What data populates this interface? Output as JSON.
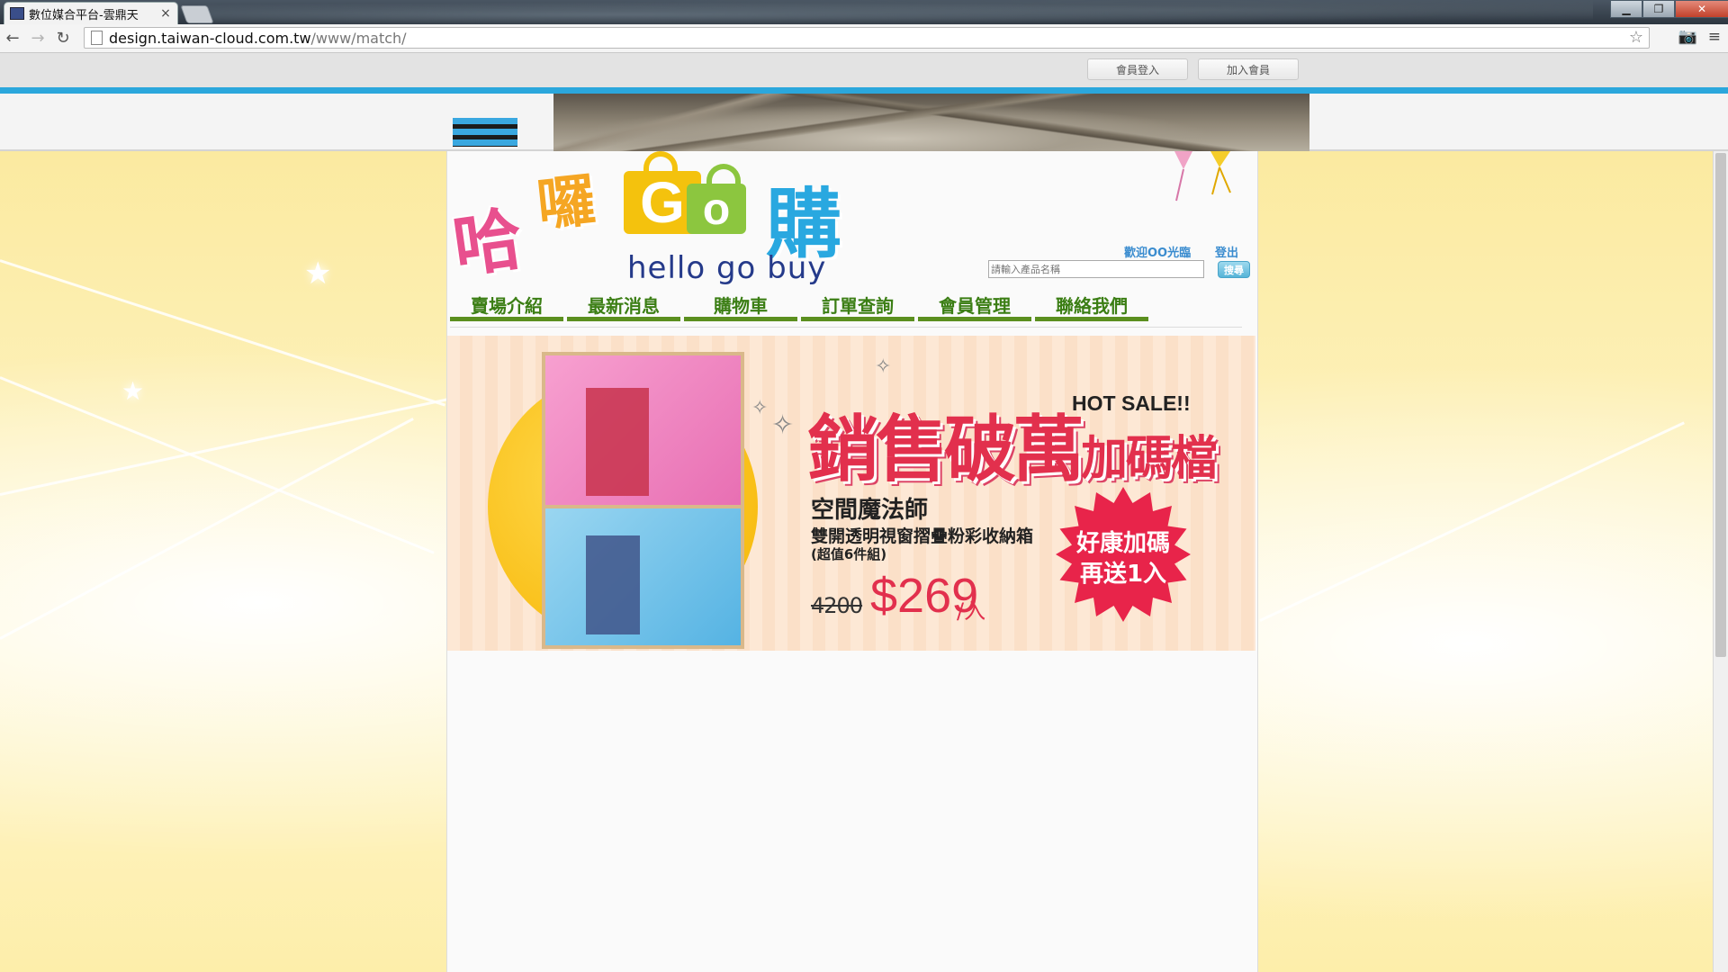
{
  "browser": {
    "tab_title": "數位媒合平台-雲鼎天",
    "tab_close": "×",
    "url_host": "design.taiwan-cloud.com.tw",
    "url_path": "/www/match/",
    "back": "←",
    "forward": "→",
    "reload": "↻",
    "star": "☆",
    "menu": "≡",
    "extension": "📷",
    "win_min": "▁",
    "win_max": "❐",
    "win_close": "✕"
  },
  "member_bar": {
    "login": "會員登入",
    "join": "加入會員"
  },
  "header": {
    "logo_ha": "哈",
    "logo_luo": "囉",
    "logo_go_g": "G",
    "logo_go_o": "o",
    "logo_gou": "購",
    "logo_english": "hello  go  buy",
    "welcome": "歡迎OO光臨",
    "logout": "登出",
    "search_placeholder": "請輸入產品名稱",
    "search_button": "搜尋"
  },
  "menu": {
    "items": [
      {
        "label": "賣場介紹"
      },
      {
        "label": "最新消息"
      },
      {
        "label": "購物車"
      },
      {
        "label": "訂單查詢"
      },
      {
        "label": "會員管理"
      },
      {
        "label": "聯絡我們"
      }
    ]
  },
  "promo": {
    "hot_sale": "HOT SALE!!",
    "headline_main": "銷售破萬",
    "headline_tail": "加碼檔",
    "product_title": "空間魔法師",
    "product_subtitle": "雙開透明視窗摺疊粉彩收納箱",
    "product_note": "(超值6件組)",
    "old_price": "4200",
    "new_price": "$269",
    "per_unit": "/入",
    "burst_line1": "好康加碼",
    "burst_line2": "再送1入",
    "colors": {
      "accent": "#e2304d",
      "menu_green": "#3b7e14",
      "header_blue": "#2ba7dc"
    }
  }
}
